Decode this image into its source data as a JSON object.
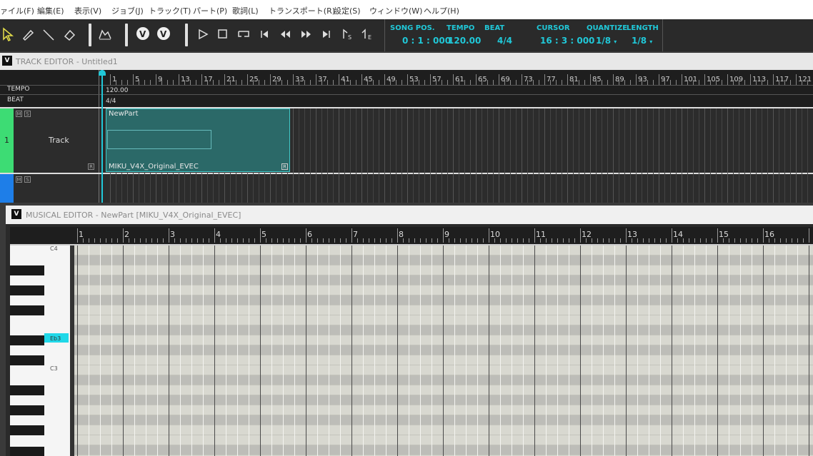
{
  "menu": [
    "ァイル(F)",
    "編集(E)",
    "表示(V)",
    "ジョブ(J)",
    "トラック(T)",
    "パート(P)",
    "歌詞(L)",
    "トランスポート(R)",
    "設定(S)",
    "ウィンドウ(W)",
    "ヘルプ(H)"
  ],
  "toolbar": {
    "song_pos_label": "SONG POS.",
    "song_pos_value": "0 : 1 : 000",
    "tempo_label": "TEMPO",
    "tempo_value": "120.00",
    "beat_label": "BEAT",
    "beat_value": "4/4",
    "cursor_label": "CURSOR",
    "cursor_value": "16 : 3 : 000",
    "quantize_label": "QUANTIZE",
    "quantize_value": "1/8",
    "length_label": "LENGTH",
    "length_value": "1/8",
    "play_mode_icons": [
      "V",
      "V"
    ]
  },
  "track_editor": {
    "title": "TRACK EDITOR - Untitled1",
    "v_badge": "V",
    "ruler_marks": [
      "1",
      "5",
      "9",
      "13",
      "17",
      "21",
      "25",
      "29",
      "33",
      "37",
      "41",
      "45",
      "49",
      "53",
      "57",
      "61",
      "65",
      "69",
      "73",
      "77",
      "81",
      "85",
      "89",
      "93",
      "97",
      "101",
      "105",
      "109",
      "113",
      "117",
      "121"
    ],
    "tempo_label": "TEMPO",
    "tempo_value": "120.00",
    "beat_label": "BEAT",
    "beat_value": "4/4",
    "tracks": [
      {
        "number": "1",
        "name": "Track",
        "m": "M",
        "s": "S",
        "r": "R"
      },
      {
        "number": "",
        "name": "",
        "m": "M",
        "s": "S"
      }
    ],
    "part": {
      "name": "NewPart",
      "singer": "MIKU_V4X_Original_EVEC",
      "r": "R"
    }
  },
  "musical_editor": {
    "title": "MUSICAL EDITOR - NewPart [MIKU_V4X_Original_EVEC]",
    "v_badge": "V",
    "measures": [
      "1",
      "2",
      "3",
      "4",
      "5",
      "6",
      "7",
      "8",
      "9",
      "10",
      "11",
      "12",
      "13",
      "14",
      "15",
      "16"
    ],
    "key_labels": [
      "C4",
      "Eb3",
      "C3"
    ]
  },
  "colors": {
    "accent": "#20c8d8",
    "track_green": "#3ddc74",
    "track_blue": "#1e7ee8",
    "part_fill": "#2b6968"
  }
}
